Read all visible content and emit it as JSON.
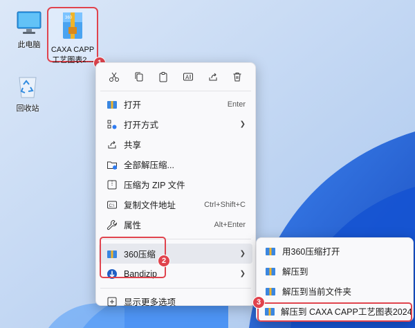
{
  "desktop": {
    "this_pc": "此电脑",
    "recycle_bin": "回收站",
    "selected_file": {
      "line1": "CAXA CAPP",
      "line2": "工艺图表2..."
    },
    "archive_badge": "360\nZIP"
  },
  "badges": [
    "1",
    "2",
    "3"
  ],
  "context_menu": {
    "toolbar": [
      "cut-icon",
      "copy-icon",
      "paste-icon",
      "rename-icon",
      "share-icon",
      "delete-icon"
    ],
    "items": [
      {
        "label": "打开",
        "shortcut": "Enter"
      },
      {
        "label": "打开方式",
        "submenu": true
      },
      {
        "label": "共享"
      },
      {
        "label": "全部解压缩..."
      },
      {
        "label": "压缩为 ZIP 文件"
      },
      {
        "label": "复制文件地址",
        "shortcut": "Ctrl+Shift+C"
      },
      {
        "label": "属性",
        "shortcut": "Alt+Enter"
      }
    ],
    "group2": [
      {
        "label": "360压缩",
        "submenu": true
      },
      {
        "label": "Bandizip",
        "submenu": true
      }
    ],
    "more": "显示更多选项"
  },
  "submenu_360": {
    "items": [
      "用360压缩打开",
      "解压到",
      "解压到当前文件夹",
      "解压到 CAXA CAPP工艺图表2024"
    ]
  },
  "colors": {
    "accent_red": "#e0434d",
    "menu_bg": "#f9f9fb"
  }
}
